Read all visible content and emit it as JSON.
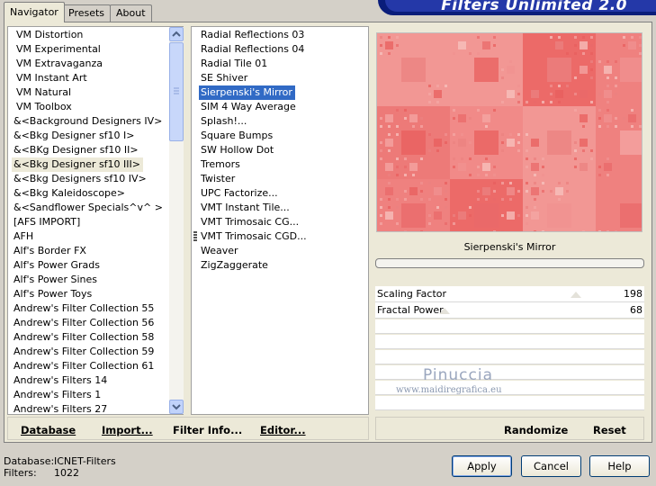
{
  "tabs": [
    "Navigator",
    "Presets",
    "About"
  ],
  "brand": "Filters Unlimited 2.0",
  "categories": [
    "VM Distortion",
    "VM Experimental",
    "VM Extravaganza",
    "VM Instant Art",
    "VM Natural",
    "VM Toolbox",
    "&<Background Designers IV>",
    "&<Bkg Designer sf10 I>",
    "&<BKg Designer sf10 II>",
    "&<Bkg Designer sf10 III>",
    "&<Bkg Designers sf10 IV>",
    "&<Bkg Kaleidoscope>",
    "&<Sandflower Specials^v^ >",
    "[AFS IMPORT]",
    "AFH",
    "Alf's Border FX",
    "Alf's Power Grads",
    "Alf's Power Sines",
    "Alf's Power Toys",
    "Andrew's Filter Collection 55",
    "Andrew's Filter Collection 56",
    "Andrew's Filter Collection 58",
    "Andrew's Filter Collection 59",
    "Andrew's Filter Collection 61",
    "Andrew's Filters 14",
    "Andrew's Filters 1",
    "Andrew's Filters 27"
  ],
  "selected_category": "&<Bkg Designer sf10 III>",
  "filters": [
    "Radial Reflections 03",
    "Radial Reflections 04",
    "Radial Tile 01",
    "SE Shiver",
    "Sierpenski's Mirror",
    "SIM 4 Way Average",
    "Splash!...",
    "Square Bumps",
    "SW Hollow Dot",
    "Tremors",
    "Twister",
    "UPC Factorize...",
    "VMT Instant Tile...",
    "VMT Trimosaic CG...",
    "VMT Trimosaic CGD...",
    "Weaver",
    "ZigZaggerate"
  ],
  "selected_filter": "Sierpenski's Mirror",
  "preview_caption": "Sierpenski's Mirror",
  "params": [
    {
      "label": "Scaling Factor",
      "value": "198",
      "level": 0.776
    },
    {
      "label": "Fractal Power",
      "value": "68",
      "level": 0.267
    }
  ],
  "watermark": {
    "name": "Pinuccia",
    "url": "www.maidiregrafica.eu"
  },
  "left_buttons": [
    "Database",
    "Import...",
    "Filter Info...",
    "Editor..."
  ],
  "right_buttons": [
    "Randomize",
    "Reset"
  ],
  "status": {
    "database_label": "Database:",
    "database_value": "ICNET-Filters",
    "filters_label": "Filters:",
    "filters_value": "1022"
  },
  "dialog_buttons": {
    "apply": "Apply",
    "cancel": "Cancel",
    "help": "Help"
  },
  "colors": {
    "selection": "#316ac5",
    "preview": "#ee7472",
    "brand_bg": "#0a1d7a"
  }
}
